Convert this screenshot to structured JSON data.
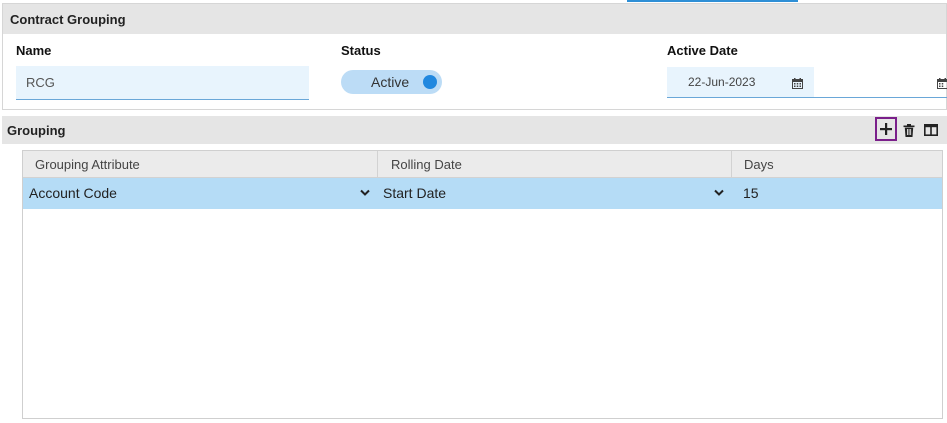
{
  "contract_grouping": {
    "title": "Contract Grouping",
    "name": {
      "label": "Name",
      "value": "RCG"
    },
    "status": {
      "label": "Status",
      "value": "Active"
    },
    "active_date": {
      "label": "Active Date",
      "value": "22-Jun-2023"
    }
  },
  "grouping": {
    "title": "Grouping",
    "toolbar": {
      "add_icon": "plus-icon",
      "delete_icon": "trash-icon",
      "columns_icon": "columns-icon"
    },
    "columns": [
      "Grouping Attribute",
      "Rolling Date",
      "Days"
    ],
    "rows": [
      {
        "grouping_attribute": "Account Code",
        "rolling_date": "Start Date",
        "days": "15"
      }
    ]
  },
  "colors": {
    "accent": "#2188df",
    "selected_row": "#b5dcf6",
    "input_bg": "#e8f4fd",
    "header_bg": "#e5e5e5",
    "highlight_border": "#7a1f8a"
  }
}
